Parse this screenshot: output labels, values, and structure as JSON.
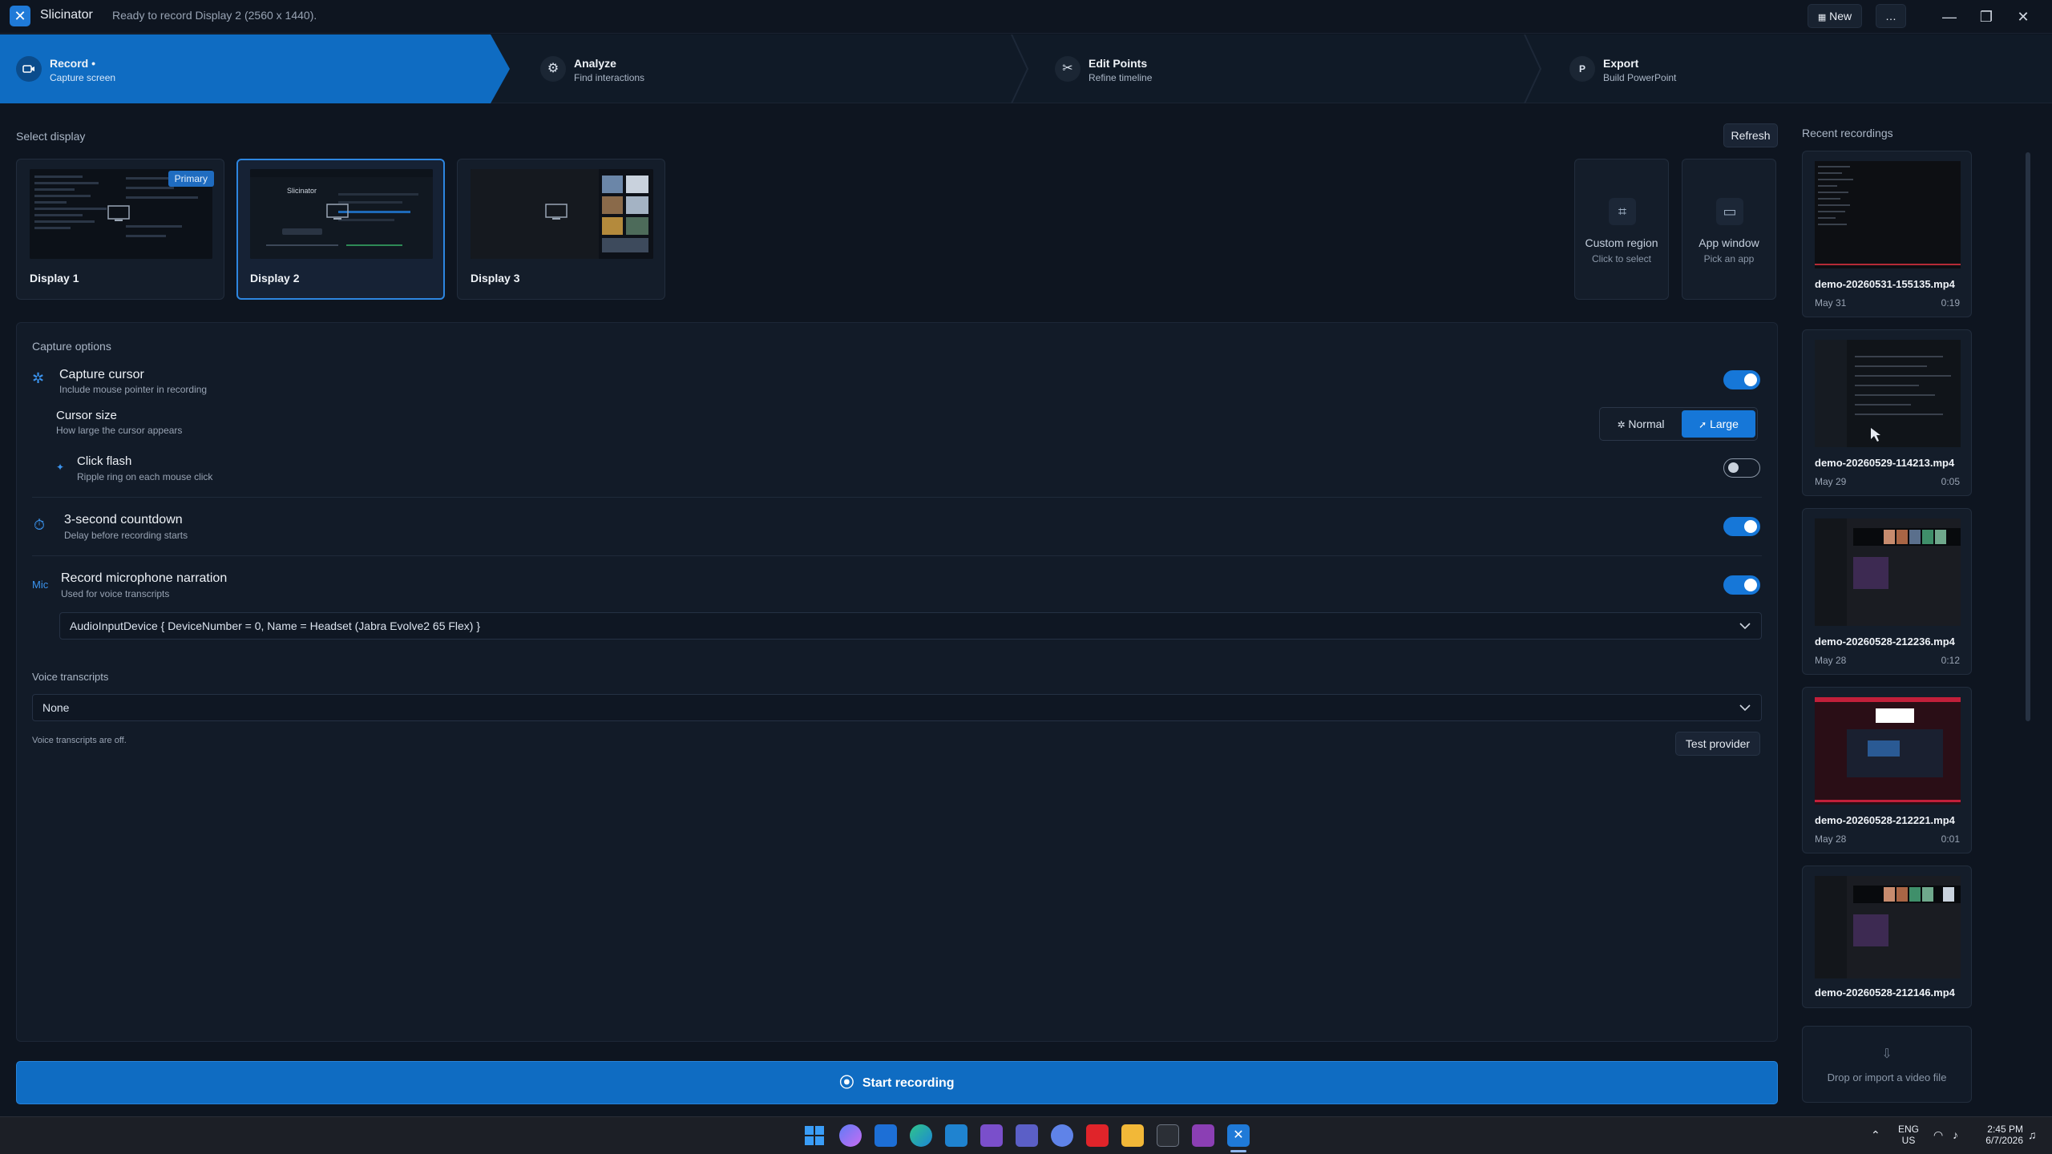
{
  "titlebar": {
    "app_name": "Slicinator",
    "status": "Ready to record Display 2 (2560 x 1440).",
    "new_label": "New",
    "more_label": "…"
  },
  "steps": [
    {
      "title": "Record •",
      "subtitle": "Capture screen"
    },
    {
      "title": "Analyze",
      "subtitle": "Find interactions"
    },
    {
      "title": "Edit Points",
      "subtitle": "Refine timeline"
    },
    {
      "title": "Export",
      "subtitle": "Build PowerPoint"
    }
  ],
  "display_select": {
    "label": "Select display",
    "refresh_label": "Refresh",
    "displays": [
      {
        "name": "Display 1",
        "badge": "Primary"
      },
      {
        "name": "Display 2"
      },
      {
        "name": "Display 3"
      }
    ],
    "thumb_text": "Slicinator",
    "custom_region": {
      "title": "Custom region",
      "subtitle": "Click to select"
    },
    "app_window": {
      "title": "App window",
      "subtitle": "Pick an app"
    }
  },
  "capture": {
    "label": "Capture options",
    "capture_cursor": {
      "title": "Capture cursor",
      "subtitle": "Include mouse pointer in recording",
      "on": true
    },
    "cursor_size": {
      "title": "Cursor size",
      "subtitle": "How large the cursor appears",
      "options": [
        "Normal",
        "Large"
      ],
      "selected": "Large"
    },
    "click_flash": {
      "title": "Click flash",
      "subtitle": "Ripple ring on each mouse click",
      "on": false
    },
    "countdown": {
      "title": "3-second countdown",
      "subtitle": "Delay before recording starts",
      "on": true
    },
    "mic": {
      "icon_label": "Mic",
      "title": "Record microphone narration",
      "subtitle": "Used for voice transcripts",
      "on": true,
      "device": "AudioInputDevice { DeviceNumber = 0, Name = Headset (Jabra Evolve2 65 Flex) }"
    },
    "voice": {
      "label": "Voice transcripts",
      "selected": "None",
      "status": "Voice transcripts are off.",
      "test_label": "Test provider"
    }
  },
  "start_label": "Start recording",
  "recent": {
    "label": "Recent recordings",
    "items": [
      {
        "name": "demo-20260531-155135.mp4",
        "date": "May 31",
        "duration": "0:19"
      },
      {
        "name": "demo-20260529-114213.mp4",
        "date": "May 29",
        "duration": "0:05"
      },
      {
        "name": "demo-20260528-212236.mp4",
        "date": "May 28",
        "duration": "0:12"
      },
      {
        "name": "demo-20260528-212221.mp4",
        "date": "May 28",
        "duration": "0:01"
      },
      {
        "name": "demo-20260528-212146.mp4",
        "date": "",
        "duration": ""
      }
    ],
    "drop_label": "Drop or import a video file"
  },
  "taskbar": {
    "lang_top": "ENG",
    "lang_bottom": "US",
    "time": "2:45 PM",
    "date": "6/7/2026"
  },
  "colors": {
    "accent": "#1677d8",
    "active_step": "#0f6cc2",
    "background": "#0e1520"
  }
}
